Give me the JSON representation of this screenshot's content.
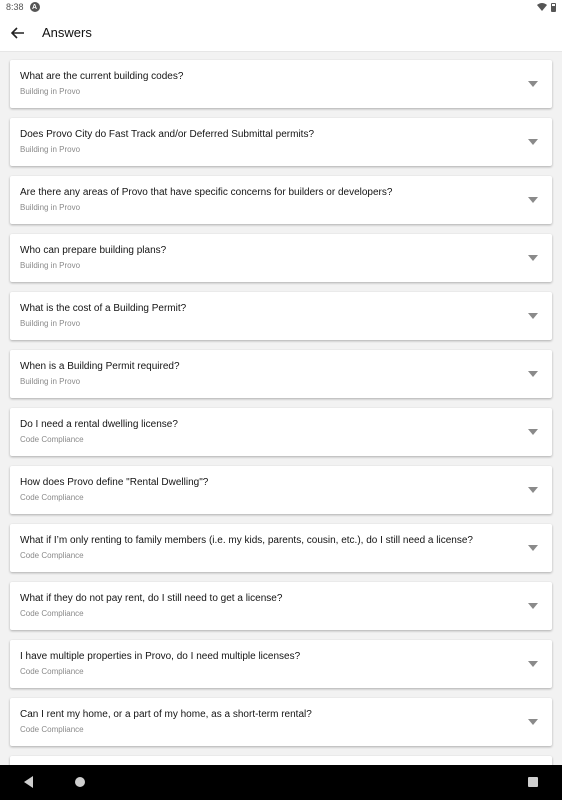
{
  "status_bar": {
    "time": "8:38",
    "badge": "A"
  },
  "app_bar": {
    "title": "Answers"
  },
  "questions": [
    {
      "title": "What are the current building codes?",
      "category": "Building in Provo"
    },
    {
      "title": "Does Provo City do Fast Track and/or Deferred Submittal permits?",
      "category": "Building in Provo"
    },
    {
      "title": "Are there any areas of Provo that have specific concerns for builders or developers?",
      "category": "Building in Provo"
    },
    {
      "title": "Who can prepare building plans?",
      "category": "Building in Provo"
    },
    {
      "title": "What is the cost of a Building Permit?",
      "category": "Building in Provo"
    },
    {
      "title": "When is a Building Permit required?",
      "category": "Building in Provo"
    },
    {
      "title": "Do I need a rental dwelling license?",
      "category": "Code Compliance"
    },
    {
      "title": "How does Provo define \"Rental Dwelling\"?",
      "category": "Code Compliance"
    },
    {
      "title": "What if I’m only renting to family members (i.e. my kids, parents, cousin, etc.), do I still need a license?",
      "category": "Code Compliance"
    },
    {
      "title": "What if they do not pay rent, do I still need to get a license?",
      "category": "Code Compliance"
    },
    {
      "title": "I have multiple properties in Provo, do I need multiple licenses?",
      "category": "Code Compliance"
    },
    {
      "title": "Can I rent my home, or a part of my home, as a short-term rental?",
      "category": "Code Compliance"
    }
  ],
  "icons": {
    "back": "arrow-left-icon",
    "expand": "chevron-down-icon",
    "nav_back": "nav-back-icon",
    "nav_home": "nav-home-icon",
    "nav_recents": "nav-recents-icon"
  }
}
